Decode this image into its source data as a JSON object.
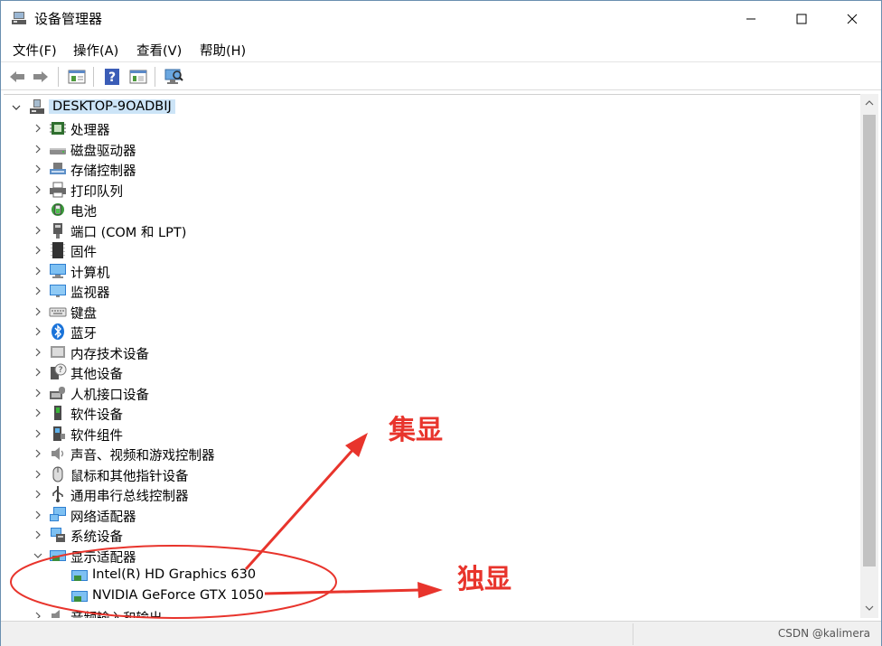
{
  "window": {
    "title": "设备管理器"
  },
  "menu": [
    "文件(F)",
    "操作(A)",
    "查看(V)",
    "帮助(H)"
  ],
  "toolbar": [
    "back-icon",
    "forward-icon",
    "properties-icon",
    "help-icon",
    "view-icon",
    "scan-icon"
  ],
  "tree": {
    "root": "DESKTOP-9OADBIJ",
    "categories": [
      {
        "label": "处理器",
        "icon": "processor-icon"
      },
      {
        "label": "磁盘驱动器",
        "icon": "disk-icon"
      },
      {
        "label": "存储控制器",
        "icon": "storage-icon"
      },
      {
        "label": "打印队列",
        "icon": "printer-icon"
      },
      {
        "label": "电池",
        "icon": "battery-icon"
      },
      {
        "label": "端口 (COM 和 LPT)",
        "icon": "port-icon"
      },
      {
        "label": "固件",
        "icon": "firmware-icon"
      },
      {
        "label": "计算机",
        "icon": "computer-icon"
      },
      {
        "label": "监视器",
        "icon": "monitor-icon"
      },
      {
        "label": "键盘",
        "icon": "keyboard-icon"
      },
      {
        "label": "蓝牙",
        "icon": "bluetooth-icon"
      },
      {
        "label": "内存技术设备",
        "icon": "memory-icon"
      },
      {
        "label": "其他设备",
        "icon": "other-device-icon"
      },
      {
        "label": "人机接口设备",
        "icon": "hid-icon"
      },
      {
        "label": "软件设备",
        "icon": "software-device-icon"
      },
      {
        "label": "软件组件",
        "icon": "software-component-icon"
      },
      {
        "label": "声音、视频和游戏控制器",
        "icon": "sound-icon"
      },
      {
        "label": "鼠标和其他指针设备",
        "icon": "mouse-icon"
      },
      {
        "label": "通用串行总线控制器",
        "icon": "usb-icon"
      },
      {
        "label": "网络适配器",
        "icon": "network-icon"
      },
      {
        "label": "系统设备",
        "icon": "system-device-icon"
      },
      {
        "label": "显示适配器",
        "icon": "display-adapter-icon"
      }
    ],
    "display_children": [
      "Intel(R) HD Graphics 630",
      "NVIDIA GeForce GTX 1050"
    ],
    "partial_row": "音频输入和输出"
  },
  "annotations": {
    "integrated": "集显",
    "discrete": "独显",
    "color": "#e8342c"
  },
  "watermark": "CSDN @kalimera"
}
